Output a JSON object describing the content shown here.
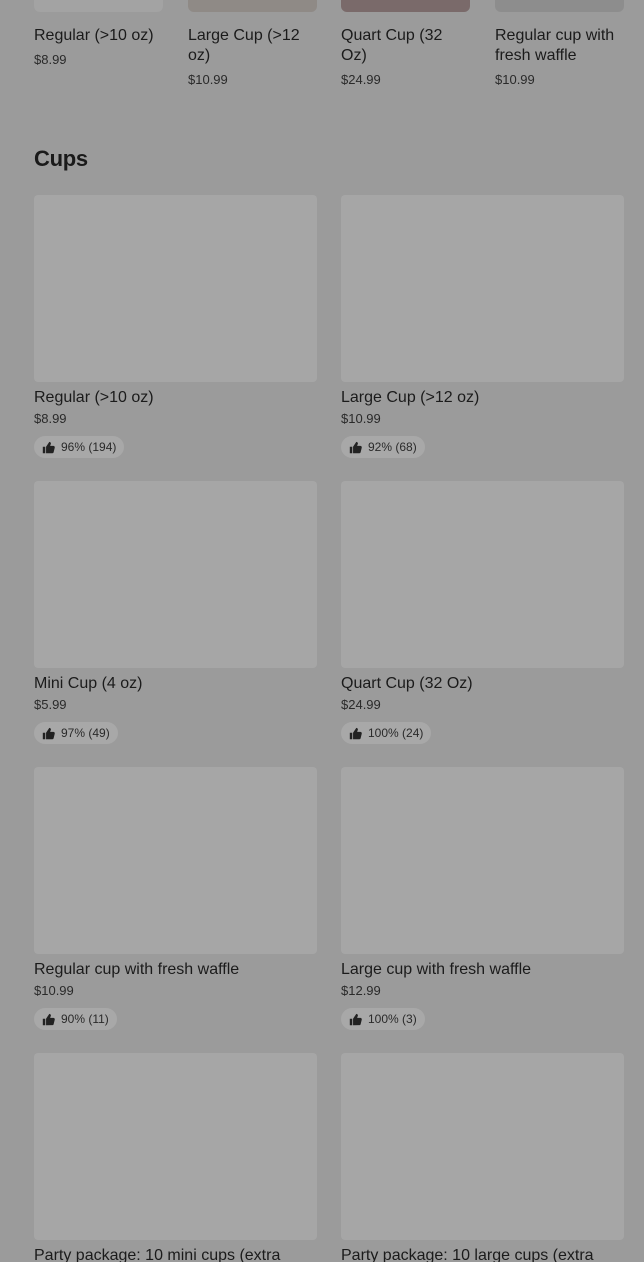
{
  "carousel": [
    {
      "name": "Regular (>10 oz)",
      "price": "$8.99",
      "thumb_color": "#a3a3a3"
    },
    {
      "name": "Large Cup (>12 oz)",
      "price": "$10.99",
      "thumb_color": "#8f8a86"
    },
    {
      "name": "Quart Cup (32 Oz)",
      "price": "$24.99",
      "thumb_color": "#7a6a6a"
    },
    {
      "name": "Regular cup with fresh waffle",
      "price": "$10.99",
      "thumb_color": "#8d8d8d"
    }
  ],
  "section": {
    "title": "Cups"
  },
  "items": [
    {
      "name": "Regular (>10 oz)",
      "price": "$8.99",
      "rating": "96% (194)"
    },
    {
      "name": "Large Cup (>12 oz)",
      "price": "$10.99",
      "rating": "92% (68)"
    },
    {
      "name": "Mini Cup (4 oz)",
      "price": "$5.99",
      "rating": "97% (49)"
    },
    {
      "name": "Quart Cup (32 Oz)",
      "price": "$24.99",
      "rating": "100% (24)"
    },
    {
      "name": "Regular cup with fresh waffle",
      "price": "$10.99",
      "rating": "90% (11)"
    },
    {
      "name": "Large cup with fresh waffle",
      "price": "$12.99",
      "rating": "100% (3)"
    },
    {
      "name": "Party package: 10 mini cups (extra",
      "price": "",
      "rating": ""
    },
    {
      "name": "Party package: 10 large cups (extra",
      "price": "",
      "rating": ""
    }
  ]
}
